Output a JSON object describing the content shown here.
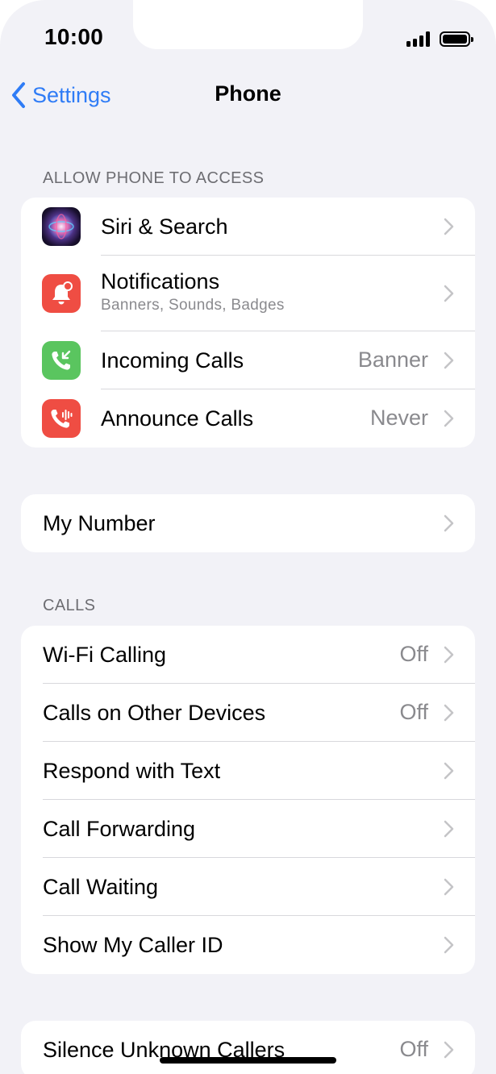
{
  "status": {
    "time": "10:00"
  },
  "nav": {
    "back_label": "Settings",
    "title": "Phone"
  },
  "section_access": {
    "header": "ALLOW PHONE TO ACCESS",
    "items": [
      {
        "label": "Siri & Search",
        "sublabel": "",
        "value": ""
      },
      {
        "label": "Notifications",
        "sublabel": "Banners, Sounds, Badges",
        "value": ""
      },
      {
        "label": "Incoming Calls",
        "sublabel": "",
        "value": "Banner"
      },
      {
        "label": "Announce Calls",
        "sublabel": "",
        "value": "Never"
      }
    ]
  },
  "my_number": {
    "label": "My Number"
  },
  "section_calls": {
    "header": "CALLS",
    "items": [
      {
        "label": "Wi-Fi Calling",
        "value": "Off"
      },
      {
        "label": "Calls on Other Devices",
        "value": "Off"
      },
      {
        "label": "Respond with Text",
        "value": ""
      },
      {
        "label": "Call Forwarding",
        "value": ""
      },
      {
        "label": "Call Waiting",
        "value": ""
      },
      {
        "label": "Show My Caller ID",
        "value": ""
      }
    ]
  },
  "silence": {
    "label": "Silence Unknown Callers",
    "value": "Off"
  },
  "colors": {
    "accent": "#2f7cf6",
    "background": "#f2f2f7",
    "notifications_icon": "#ef4d43",
    "incoming_icon": "#5ac55f",
    "announce_icon": "#ef4d43"
  },
  "icons": {
    "siri": "siri-icon",
    "notifications": "bell-icon",
    "incoming": "incoming-call-icon",
    "announce": "announce-call-icon"
  }
}
